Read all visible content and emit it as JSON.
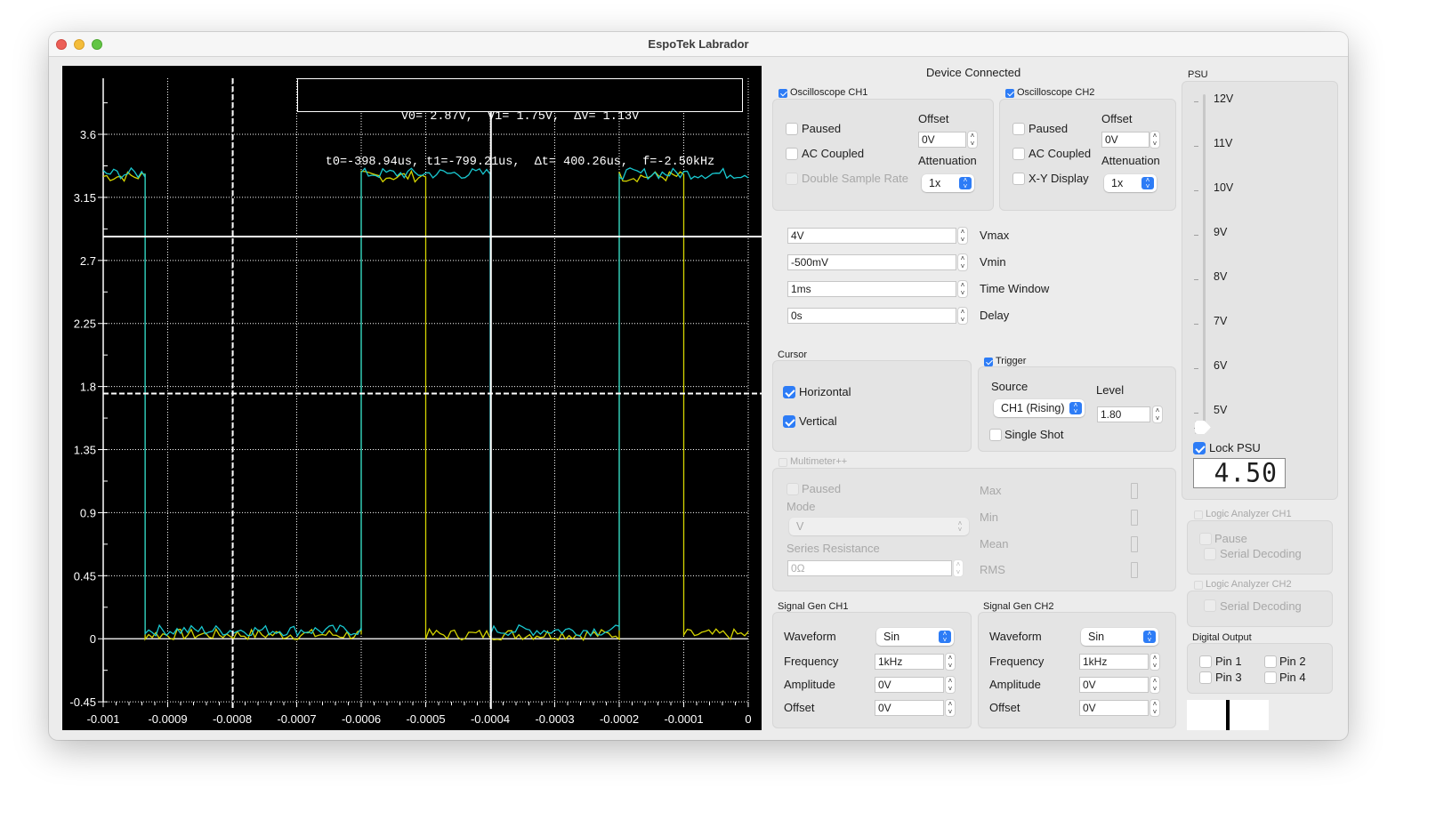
{
  "window": {
    "title": "EspoTek Labrador"
  },
  "scope": {
    "readout_line1": "V0= 2.87V,  V1= 1.75V,  ΔV= 1.13V",
    "readout_line2": "t0=-398.94us, t1=-799.21us,  Δt= 400.26us,  f=-2.50kHz",
    "colors": {
      "ch1": "#d4d400",
      "ch2": "#19c8d0",
      "grid": "#ffffff",
      "background": "#000000"
    }
  },
  "chart_data": {
    "type": "line",
    "title": "",
    "xlabel": "",
    "ylabel": "",
    "xlim": [
      -0.001,
      0
    ],
    "ylim": [
      -0.5,
      4.0
    ],
    "x_ticks": [
      "-0.001",
      "-0.0009",
      "-0.0008",
      "-0.0007",
      "-0.0006",
      "-0.0005",
      "-0.0004",
      "-0.0003",
      "-0.0002",
      "-0.0001",
      "0"
    ],
    "x_tick_values": [
      -0.001,
      -0.0009,
      -0.0008,
      -0.0007,
      -0.0006,
      -0.0005,
      -0.0004,
      -0.0003,
      -0.0002,
      -0.0001,
      0
    ],
    "y_ticks": [
      "3.6",
      "3.15",
      "2.7",
      "2.25",
      "1.8",
      "1.35",
      "0.9",
      "0.45",
      "0",
      "-0.45"
    ],
    "y_tick_values": [
      3.6,
      3.15,
      2.7,
      2.25,
      1.8,
      1.35,
      0.9,
      0.45,
      0,
      -0.45
    ],
    "grid": true,
    "series": [
      {
        "name": "CH1",
        "color": "#d4d400",
        "x": [
          -0.001,
          -0.000935,
          -0.000935,
          -0.0006,
          -0.0006,
          -0.0005,
          -0.0005,
          -0.0002,
          -0.0002,
          -0.0001,
          -0.0001,
          0
        ],
        "y": [
          3.3,
          3.3,
          0.03,
          0.03,
          3.3,
          3.3,
          0.03,
          0.03,
          3.3,
          3.3,
          0.03,
          0.03
        ]
      },
      {
        "name": "CH2",
        "color": "#19c8d0",
        "x": [
          -0.001,
          -0.000935,
          -0.000935,
          -0.0006,
          -0.0006,
          -0.0004,
          -0.0004,
          -0.0002,
          -0.0002,
          0
        ],
        "y": [
          3.32,
          3.32,
          0.06,
          0.06,
          3.32,
          3.32,
          0.06,
          0.06,
          3.32,
          3.32
        ]
      }
    ],
    "cursors": {
      "horizontal": [
        {
          "name": "V0",
          "value": 2.87,
          "style": "solid"
        },
        {
          "name": "V1",
          "value": 1.75,
          "style": "dashed"
        }
      ],
      "vertical": [
        {
          "name": "t0",
          "value": -0.00039894,
          "style": "solid"
        },
        {
          "name": "t1",
          "value": -0.00079921,
          "style": "dashed"
        }
      ]
    }
  },
  "status": "Device Connected",
  "osc_ch1": {
    "title": "Oscilloscope CH1",
    "enabled": true,
    "paused": "Paused",
    "ac_coupled": "AC Coupled",
    "double_sample": "Double Sample Rate",
    "offset_label": "Offset",
    "offset_value": "0V",
    "attenuation_label": "Attenuation",
    "attenuation_value": "1x"
  },
  "osc_ch2": {
    "title": "Oscilloscope CH2",
    "enabled": true,
    "paused": "Paused",
    "ac_coupled": "AC Coupled",
    "xy_display": "X-Y Display",
    "offset_label": "Offset",
    "offset_value": "0V",
    "attenuation_label": "Attenuation",
    "attenuation_value": "1x"
  },
  "scope_settings": [
    {
      "label": "Vmax",
      "value": "4V"
    },
    {
      "label": "Vmin",
      "value": "-500mV"
    },
    {
      "label": "Time Window",
      "value": "1ms"
    },
    {
      "label": "Delay",
      "value": "0s"
    }
  ],
  "cursor": {
    "title": "Cursor",
    "horizontal": "Horizontal",
    "vertical": "Vertical"
  },
  "trigger": {
    "title": "Trigger",
    "enabled": true,
    "source_label": "Source",
    "source_value": "CH1 (Rising)",
    "level_label": "Level",
    "level_value": "1.80",
    "single_shot": "Single Shot"
  },
  "multimeter": {
    "title": "Multimeter++",
    "paused": "Paused",
    "mode_label": "Mode",
    "mode_value": "V",
    "series_label": "Series Resistance",
    "series_value": "0Ω",
    "max": "Max",
    "min": "Min",
    "mean": "Mean",
    "rms": "RMS"
  },
  "siggen_ch1": {
    "title": "Signal Gen CH1",
    "waveform_label": "Waveform",
    "waveform_value": "Sin",
    "frequency_label": "Frequency",
    "frequency_value": "1kHz",
    "amplitude_label": "Amplitude",
    "amplitude_value": "0V",
    "offset_label": "Offset",
    "offset_value": "0V"
  },
  "siggen_ch2": {
    "title": "Signal Gen CH2",
    "waveform_label": "Waveform",
    "waveform_value": "Sin",
    "frequency_label": "Frequency",
    "frequency_value": "1kHz",
    "amplitude_label": "Amplitude",
    "amplitude_value": "0V",
    "offset_label": "Offset",
    "offset_value": "0V"
  },
  "psu": {
    "title": "PSU",
    "ticks": [
      "12V",
      "11V",
      "10V",
      "9V",
      "8V",
      "7V",
      "6V",
      "5V"
    ],
    "slider_value_v": 4.5,
    "lock_label": "Lock PSU",
    "display": "4.50"
  },
  "logic_ch1": {
    "title": "Logic Analyzer CH1",
    "pause": "Pause",
    "serial": "Serial Decoding"
  },
  "logic_ch2": {
    "title": "Logic Analyzer CH2",
    "serial": "Serial Decoding"
  },
  "digital_output": {
    "title": "Digital Output",
    "pins": [
      "Pin 1",
      "Pin 2",
      "Pin 3",
      "Pin 4"
    ]
  }
}
